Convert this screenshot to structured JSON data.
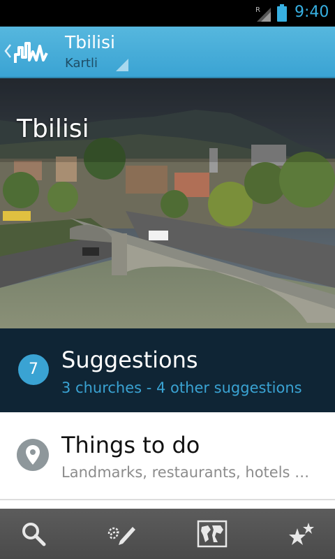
{
  "status_bar": {
    "time": "9:40",
    "roaming_indicator": "R"
  },
  "action_bar": {
    "title": "Tbilisi",
    "subtitle": "Kartli",
    "logo_icon": "city-skyline-logo-icon",
    "up_icon": "chevron-left-icon"
  },
  "hero": {
    "title": "Tbilisi"
  },
  "suggestions": {
    "count": "7",
    "title": "Suggestions",
    "subtitle": "3 churches - 4 other suggestions"
  },
  "things_to_do": {
    "title": "Things to do",
    "subtitle": "Landmarks, restaurants, hotels …",
    "icon": "map-pin-icon"
  },
  "bottom_bar": {
    "buttons": [
      "search-icon",
      "write-review-icon",
      "world-map-icon",
      "favorites-stars-icon"
    ]
  },
  "colors": {
    "accent": "#3aa3d3",
    "dark_panel": "#0f2535",
    "bottom_bar": "#4a4a4a"
  }
}
